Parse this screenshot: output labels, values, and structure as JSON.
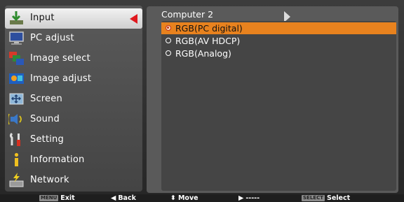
{
  "menu": {
    "items": [
      {
        "label": "Input",
        "icon": "input-icon",
        "selected": true
      },
      {
        "label": "PC adjust",
        "icon": "pc-adjust-icon"
      },
      {
        "label": "Image select",
        "icon": "image-select-icon"
      },
      {
        "label": "Image adjust",
        "icon": "image-adjust-icon"
      },
      {
        "label": "Screen",
        "icon": "screen-icon"
      },
      {
        "label": "Sound",
        "icon": "sound-icon"
      },
      {
        "label": "Setting",
        "icon": "setting-icon"
      },
      {
        "label": "Information",
        "icon": "information-icon"
      },
      {
        "label": "Network",
        "icon": "network-icon"
      }
    ]
  },
  "panel": {
    "title": "Computer 2",
    "options": [
      {
        "label": "RGB(PC digital)",
        "selected": true
      },
      {
        "label": "RGB(AV HDCP)",
        "selected": false
      },
      {
        "label": "RGB(Analog)",
        "selected": false
      }
    ]
  },
  "helpbar": {
    "exit": {
      "key": "MENU",
      "label": "Exit"
    },
    "back": {
      "glyph": "◀",
      "label": "Back"
    },
    "move": {
      "glyph": "⬍",
      "label": "Move"
    },
    "next": {
      "glyph": "▶",
      "label": "-----"
    },
    "select": {
      "key": "SELECT",
      "label": "Select"
    }
  },
  "colors": {
    "accent": "#e8821e",
    "selection_arrow": "#e0191f"
  }
}
